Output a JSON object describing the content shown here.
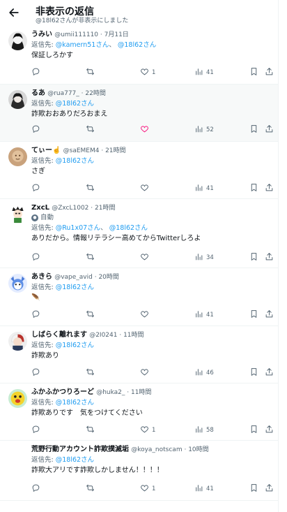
{
  "header": {
    "title": "非表示の返信",
    "subtitle": "@18l62さんが非表示にしました"
  },
  "tweets": [
    {
      "name": "うみい",
      "handle": "@umii111110",
      "time": "7月11日",
      "reply_prefix": "返信先:",
      "mentions": [
        "@kamern51さん",
        "@18l62さん"
      ],
      "mention_sep": "、",
      "text": "保証しろかす",
      "replies": "",
      "retweets": "",
      "likes": "1",
      "views": "41",
      "liked": false
    },
    {
      "name": "るあ",
      "handle": "@rua777_",
      "time": "22時間",
      "reply_prefix": "返信先:",
      "mentions": [
        "@18l62さん"
      ],
      "text": "詐欺おおありだろおまえ",
      "replies": "",
      "retweets": "",
      "likes": "",
      "views": "52",
      "liked": true
    },
    {
      "name": "てぃー☝️",
      "handle": "@saEMEM4",
      "time": "21時間",
      "reply_prefix": "返信先:",
      "mentions": [
        "@18l62さん"
      ],
      "text": "さぎ",
      "replies": "",
      "retweets": "",
      "likes": "",
      "views": "41",
      "liked": false
    },
    {
      "name": "ZxcL",
      "handle": "@ZxcL1002",
      "time": "21時間",
      "auto_label": "自動",
      "reply_prefix": "返信先:",
      "mentions": [
        "@Ru1x07さん",
        "@18l62さん"
      ],
      "mention_sep": "、",
      "text": "ありだから。情報リテラシー高めてからTwitterしろよ",
      "replies": "",
      "retweets": "",
      "likes": "",
      "views": "34",
      "liked": false
    },
    {
      "name": "あきら",
      "handle": "@vape_avid",
      "time": "20時間",
      "reply_prefix": "返信先:",
      "mentions": [
        "@18l62さん"
      ],
      "text": "🪶",
      "replies": "",
      "retweets": "",
      "likes": "",
      "views": "41",
      "liked": false
    },
    {
      "name": "しばらく離れます",
      "handle": "@2I0241",
      "time": "11時間",
      "reply_prefix": "返信先:",
      "mentions": [
        "@18l62さん"
      ],
      "text": "詐欺あり",
      "replies": "",
      "retweets": "",
      "likes": "",
      "views": "46",
      "liked": false
    },
    {
      "name": "ふかふかつりろーど",
      "handle": "@huka2_",
      "time": "11時間",
      "reply_prefix": "返信先:",
      "mentions": [
        "@18l62さん"
      ],
      "text": "詐欺ありです　気をつけてください",
      "replies": "",
      "retweets": "",
      "likes": "1",
      "views": "58",
      "liked": false
    },
    {
      "name": "荒野行動アカウント詐欺撲滅垢",
      "handle": "@koya_notscam",
      "time": "10時間",
      "reply_prefix": "返信先:",
      "mentions": [
        "@18l62さん"
      ],
      "text": "詐欺大アリです詐欺しかしません！！！！",
      "replies": "",
      "retweets": "",
      "likes": "1",
      "views": "41",
      "liked": false
    }
  ],
  "colors": {
    "accent": "#1d9bf0",
    "like": "#f91880",
    "muted": "#536471",
    "text": "#0f1419",
    "highlight_bg": "#f7f9f9"
  },
  "icons": {
    "back": "arrow-left-icon",
    "reply": "reply-icon",
    "retweet": "retweet-icon",
    "like": "heart-icon",
    "views": "views-icon",
    "bookmark": "bookmark-icon",
    "share": "share-icon"
  }
}
